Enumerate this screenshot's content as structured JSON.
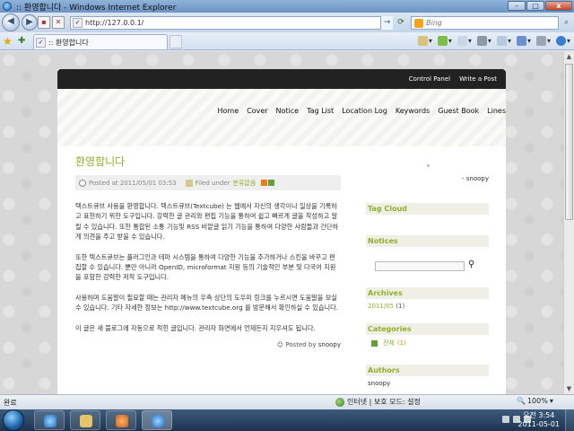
{
  "window": {
    "title": ":: 환영합니다 - Windows Internet Explorer",
    "minimize": "–",
    "maximize": "□",
    "close": "x"
  },
  "address_bar": {
    "url": "http://127.0.0.1/",
    "search_placeholder": "Bing"
  },
  "tab": {
    "title": ":: 환영합니다"
  },
  "commands": {
    "page_label": "",
    "tools_label": ""
  },
  "blog": {
    "top_links": [
      "Control Panel",
      "Write a Post"
    ],
    "nav": [
      "Home",
      "Cover",
      "Notice",
      "Tag List",
      "Location Log",
      "Keywords",
      "Guest Book",
      "Lines"
    ],
    "post": {
      "title": "환영합니다",
      "posted_at": "Posted at 2011/05/01 03:53",
      "filed_under": "Filed under",
      "category": "분류없음",
      "paragraphs": [
        "텍스트큐브 사용을 환영합니다. 텍스트큐브(Textcube) 는 웹에서 자신의 생각이나 일상을 기록하고 표현하기 위한 도구입니다. 강력한 글 관리와 편집 기능을 통하여 쉽고 빠르게 글을 작성하고 알릴 수 있습니다. 또한 통합된 소통 기능및 RSS 비깥글 읽기 기능을 통하여 다양한 사람들과 간단하게 의견을 주고 받을 수 있습니다.",
        "또한 텍스트큐브는 플러그인과 테마 시스템을 통하여 다양한 기능을 추가하거나 스킨을 바꾸고 편집할 수 있습니다. 뿐만 아니라 OpenID, microformat 지원 등의 기술적인 부분 및 다국어 지원을 포함한 강력한 저작 도구입니다.",
        "사용하며 도움말이 필요할 때는 관리자 메뉴의 우측 상단의 도우미 링크를 누르시면 도움말을 보실 수 있습니다. 기타 자세한 정보는 http://www.textcube.org 를 방문해서 확인하실 수 있습니다.",
        "이 글은 새 블로그에 자동으로 적힌 글입니다. 관리자 화면에서 언제든지 지우셔도 됩니다."
      ],
      "posted_by": "Posted by",
      "author": "snoopy"
    },
    "sidebar": {
      "author_top": "- snoopy",
      "tag_cloud": "Tag Cloud",
      "notices": "Notices",
      "archives": "Archives",
      "archive_item": "2011/05",
      "archive_count": "(1)",
      "categories": "Categories",
      "category_item": "전체",
      "category_count": "(1)",
      "authors": "Authors",
      "author_name": "snoopy"
    }
  },
  "statusbar": {
    "text": "완료",
    "zone": "인터넷 | 보호 모드: 설정",
    "zoom": "100%"
  },
  "taskbar": {
    "time": "오전 3:54",
    "date": "2011-05-01"
  },
  "colors": {
    "accent_green": "#8fb02a",
    "blog_topbar": "#222222",
    "ie_frame": "#6b93c4"
  }
}
